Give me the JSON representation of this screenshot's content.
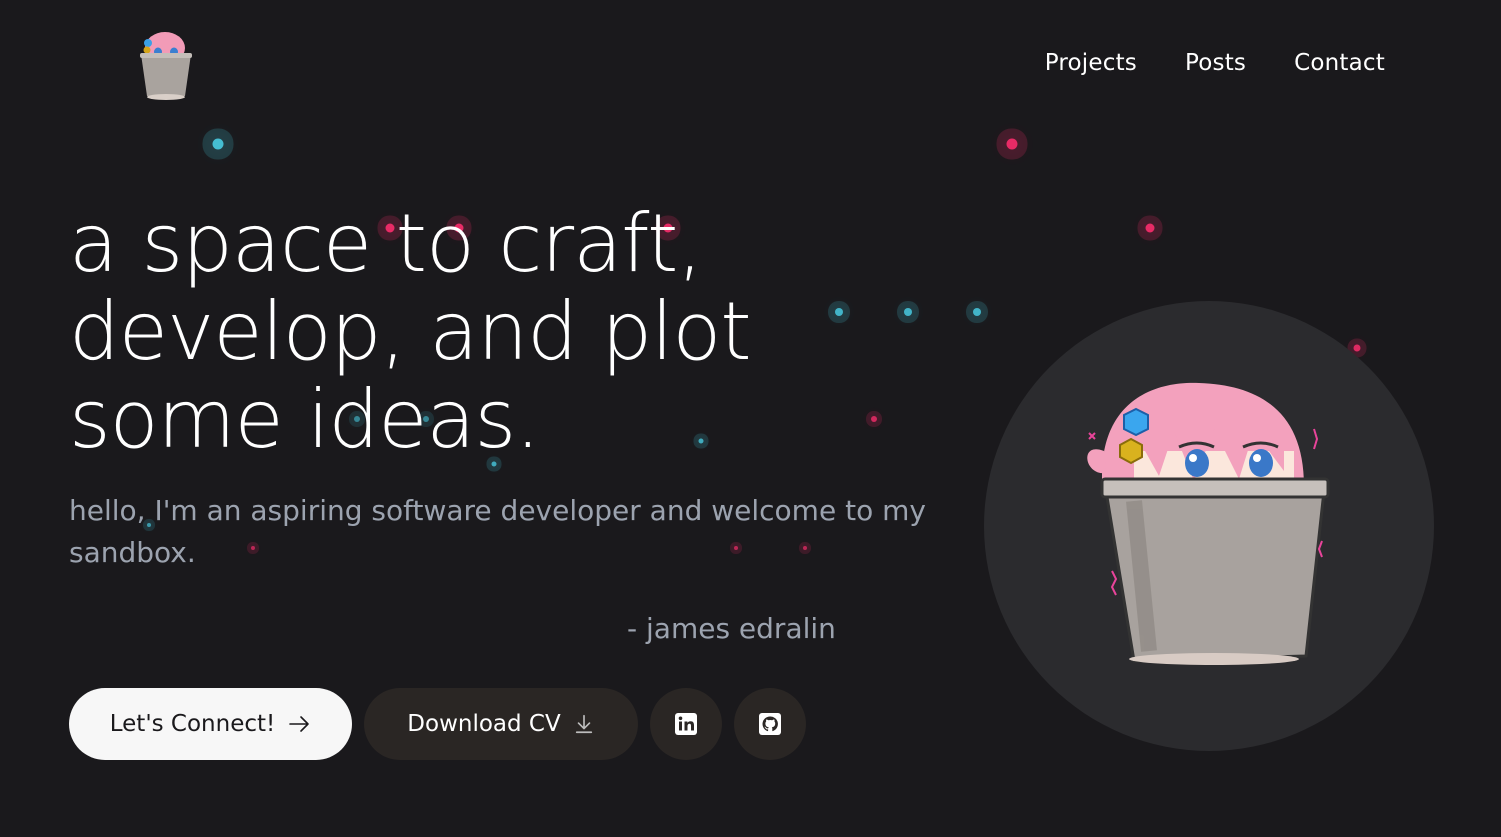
{
  "nav": {
    "logo_icon": "bucket-girl-logo-icon",
    "links": [
      {
        "label": "Projects"
      },
      {
        "label": "Posts"
      },
      {
        "label": "Contact"
      }
    ]
  },
  "hero": {
    "headline": "a space to craft, develop, and plot some ideas.",
    "intro": "hello, I'm an aspiring software developer and welcome to my sandbox.",
    "signature": "- james edralin"
  },
  "actions": {
    "connect_label": "Let's Connect!",
    "connect_icon": "arrow-right-icon",
    "cv_label": "Download CV",
    "cv_icon": "download-icon",
    "linkedin_icon": "linkedin-icon",
    "github_icon": "github-icon"
  },
  "avatar": {
    "icon": "bucket-girl-illustration-icon"
  },
  "colors": {
    "background": "#1a191c",
    "accent_pink": "#ff2d6f",
    "accent_cyan": "#4ad0e6",
    "muted_text": "#9ca3af",
    "button_light": "#f7f7f7",
    "button_dark": "#2a2624"
  }
}
